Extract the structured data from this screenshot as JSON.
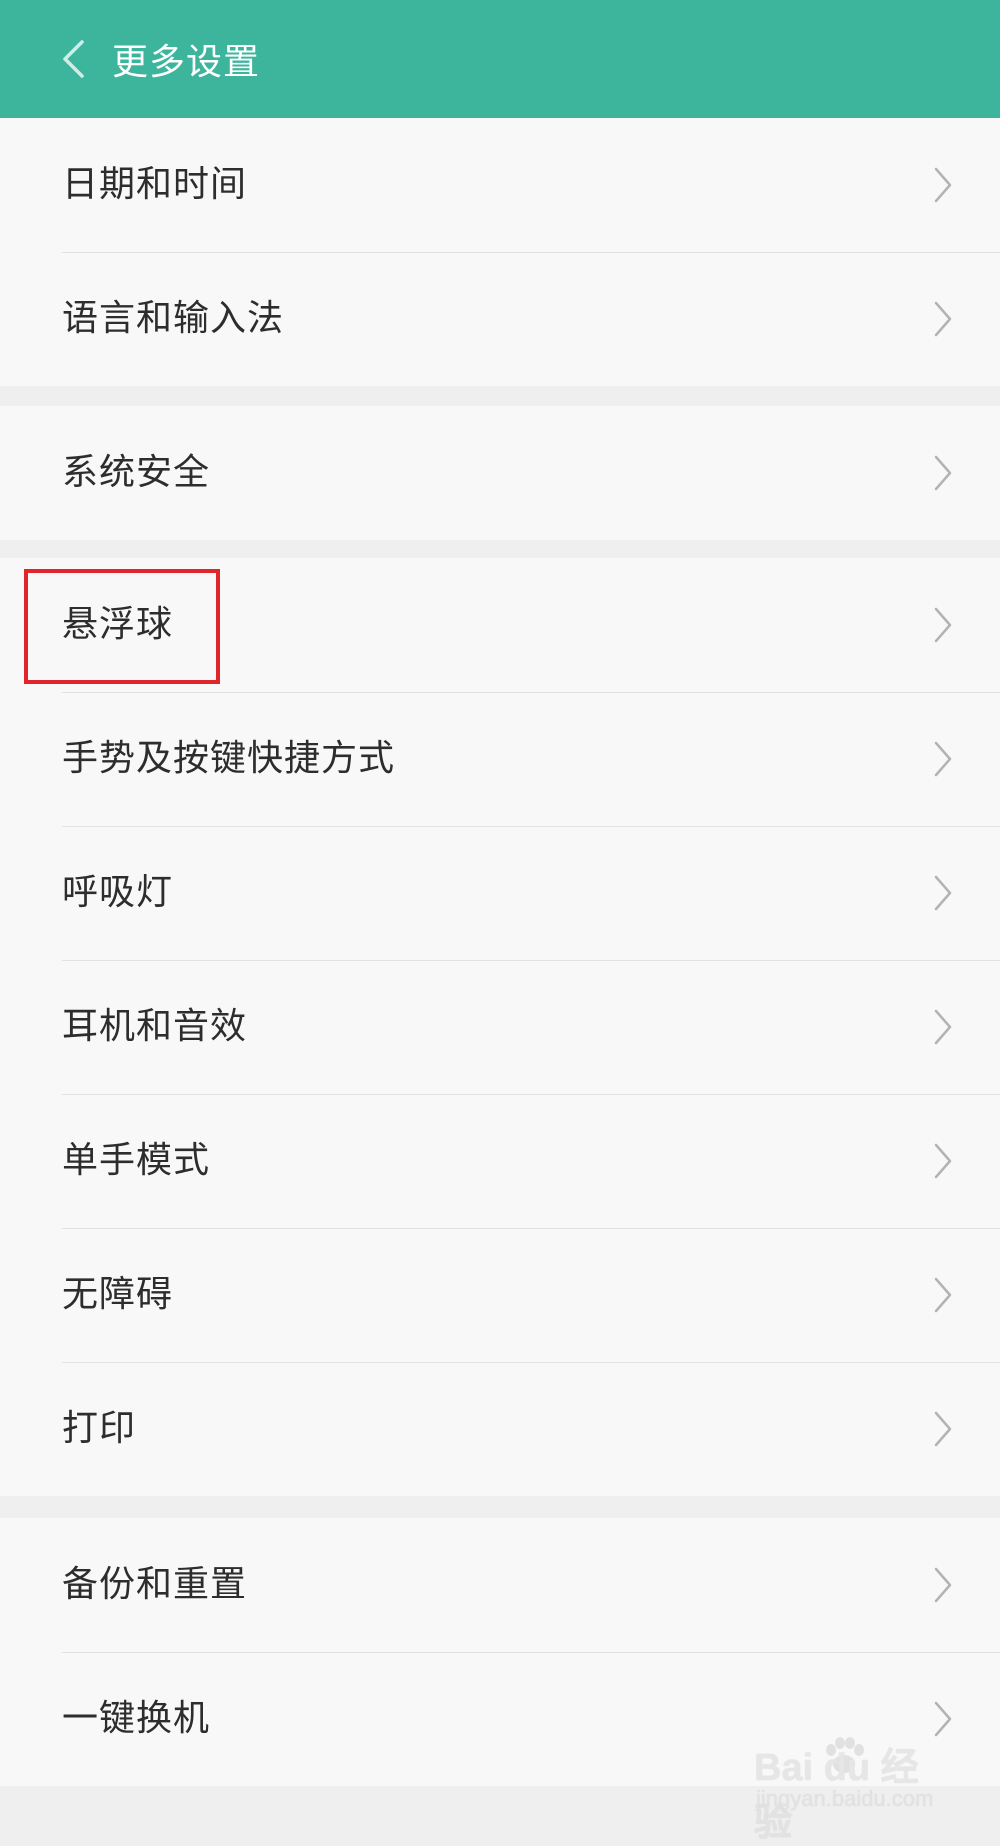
{
  "header": {
    "title": "更多设置",
    "background_color": "#3db59d"
  },
  "groups": [
    {
      "items": [
        {
          "label": "日期和时间"
        },
        {
          "label": "语言和输入法"
        }
      ]
    },
    {
      "items": [
        {
          "label": "系统安全"
        }
      ]
    },
    {
      "items": [
        {
          "label": "悬浮球",
          "highlighted": true
        },
        {
          "label": "手势及按键快捷方式"
        },
        {
          "label": "呼吸灯"
        },
        {
          "label": "耳机和音效"
        },
        {
          "label": "单手模式"
        },
        {
          "label": "无障碍"
        },
        {
          "label": "打印"
        }
      ]
    },
    {
      "items": [
        {
          "label": "备份和重置"
        },
        {
          "label": "一键换机"
        }
      ]
    }
  ],
  "highlight_color": "#e0252b",
  "watermark": {
    "main": "Bai du 经验",
    "sub": "jingyan.baidu.com"
  },
  "icons": {
    "back": "chevron-left-icon",
    "row": "chevron-right-icon"
  }
}
